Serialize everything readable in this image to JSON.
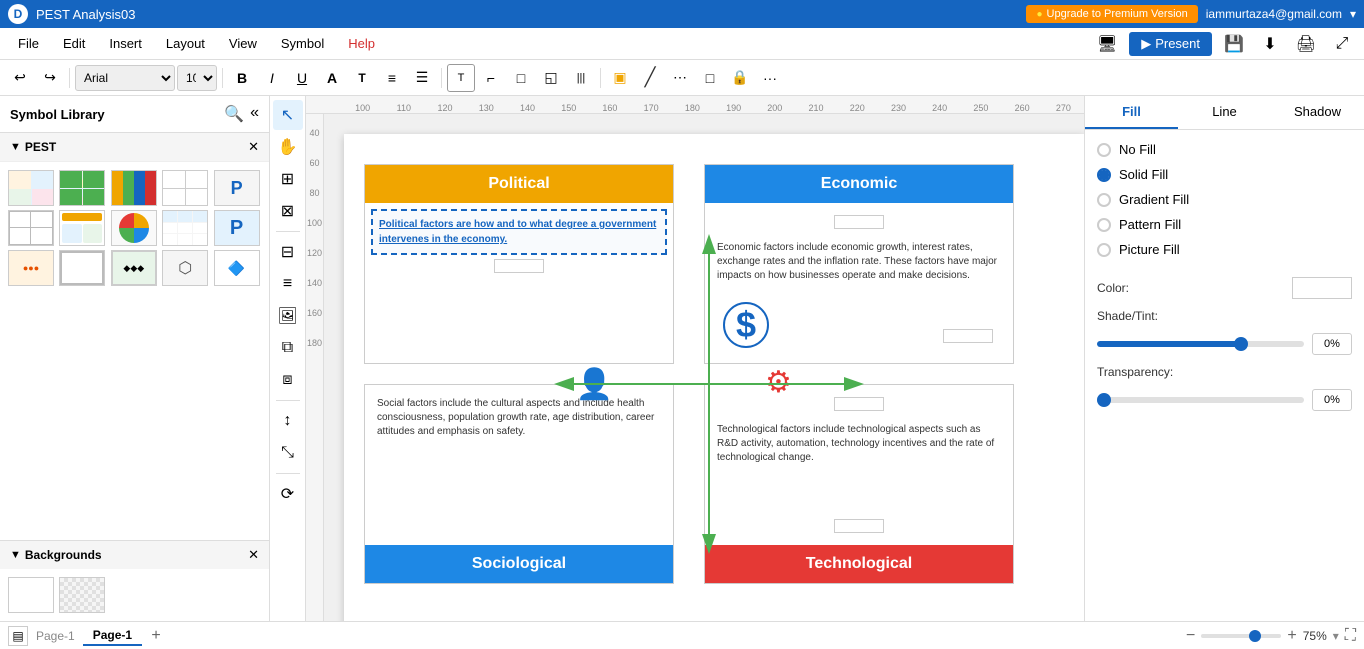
{
  "titlebar": {
    "logo": "D",
    "title": "PEST Analysis03",
    "upgrade_btn": "Upgrade to Premium Version",
    "user_email": "iammurtaza4@gmail.com"
  },
  "menubar": {
    "items": [
      {
        "label": "File",
        "color": "normal"
      },
      {
        "label": "Edit",
        "color": "normal"
      },
      {
        "label": "Insert",
        "color": "normal"
      },
      {
        "label": "Layout",
        "color": "normal"
      },
      {
        "label": "View",
        "color": "normal"
      },
      {
        "label": "Symbol",
        "color": "normal"
      },
      {
        "label": "Help",
        "color": "red"
      }
    ],
    "present_btn": "Present"
  },
  "toolbar": {
    "font": "Arial",
    "font_size": "10"
  },
  "left_panel": {
    "title": "Symbol Library",
    "pest_section_label": "PEST",
    "backgrounds_section_label": "Backgrounds"
  },
  "right_panel": {
    "tabs": [
      "Fill",
      "Line",
      "Shadow"
    ],
    "active_tab": "Fill",
    "fill_options": [
      {
        "label": "No Fill",
        "selected": false
      },
      {
        "label": "Solid Fill",
        "selected": true
      },
      {
        "label": "Gradient Fill",
        "selected": false
      },
      {
        "label": "Pattern Fill",
        "selected": false
      },
      {
        "label": "Picture Fill",
        "selected": false
      }
    ],
    "color_label": "Color:",
    "shade_tint_label": "Shade/Tint:",
    "shade_tint_value": "0%",
    "transparency_label": "Transparency:",
    "transparency_value": "0%"
  },
  "canvas": {
    "zoom": "75%"
  },
  "pest_diagram": {
    "political": {
      "header": "Political",
      "content": "Political factors are how and to what degree a government intervenes in the economy.",
      "header_color": "#f0a500"
    },
    "economic": {
      "header": "Economic",
      "content": "Economic factors include economic growth, interest rates, exchange rates and the inflation rate. These factors have major impacts on how businesses operate and make decisions.",
      "header_color": "#1e88e5"
    },
    "sociological": {
      "header": "Sociological",
      "content": "Social factors include the cultural aspects and include health consciousness, population growth rate, age distribution, career attitudes and emphasis on safety.",
      "header_color": "#1e88e5"
    },
    "technological": {
      "header": "Technological",
      "content": "Technological factors include technological aspects such as R&D activity, automation, technology incentives and the rate of technological change.",
      "header_color": "#e53935"
    }
  },
  "bottom_bar": {
    "page_label": "Page-1",
    "active_page": "Page-1",
    "add_page": "+",
    "zoom_level": "75%"
  },
  "icons": {
    "search": "🔍",
    "collapse": "«",
    "expand": "»",
    "undo": "↩",
    "redo": "↪",
    "bold": "B",
    "italic": "I",
    "underline": "U",
    "close": "✕",
    "chevron_down": "▾",
    "dollar": "$",
    "person": "👤",
    "gear": "⚙"
  }
}
